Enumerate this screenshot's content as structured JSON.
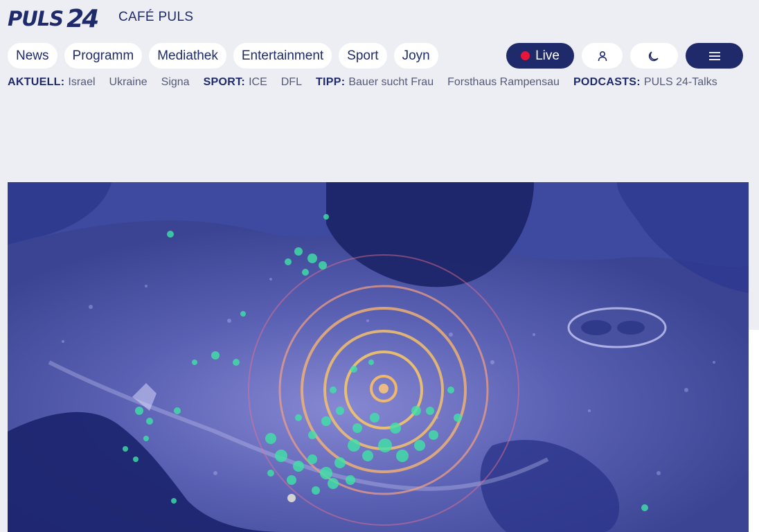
{
  "header": {
    "logo_text": "PULS",
    "logo_number": "24",
    "channel": "CAFÉ PULS"
  },
  "nav": {
    "items": [
      "News",
      "Programm",
      "Mediathek",
      "Entertainment",
      "Sport",
      "Joyn"
    ],
    "live_label": "Live"
  },
  "icons": {
    "user": "user-icon",
    "theme": "moon-icon",
    "menu": "hamburger-menu-icon",
    "live": "record-dot-icon"
  },
  "topics": {
    "aktuell_label": "AKTUELL:",
    "aktuell": [
      "Israel",
      "Ukraine",
      "Signa"
    ],
    "sport_label": "SPORT:",
    "sport": [
      "ICE",
      "DFL"
    ],
    "tipp_label": "TIPP:",
    "tipp": [
      "Bauer sucht Frau",
      "Forsthaus Rampensau"
    ],
    "podcasts_label": "PODCASTS:",
    "podcasts": [
      "PULS 24-Talks"
    ]
  },
  "colors": {
    "brand": "#1f2a6b",
    "live": "#e8173a",
    "background": "#eceef3"
  }
}
